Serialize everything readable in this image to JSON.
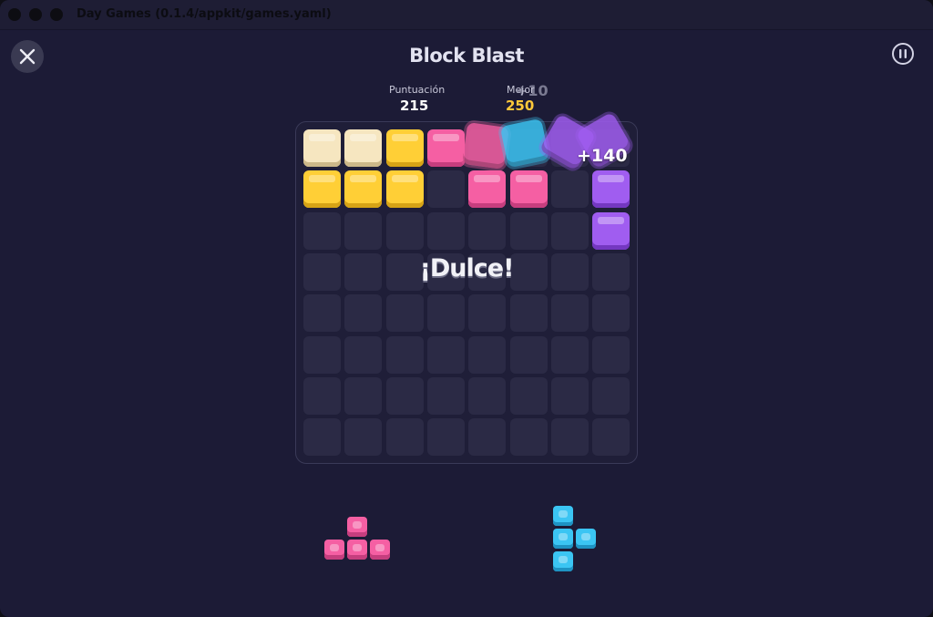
{
  "window": {
    "title": "Day Games (0.1.4/appkit/games.yaml)"
  },
  "header": {
    "title": "Block Blast"
  },
  "scores": {
    "score_label": "Puntuación",
    "score_value": "215",
    "best_label": "Mejor",
    "best_value": "250",
    "ghost_points": "+10"
  },
  "combo": {
    "text": "¡Dulce!",
    "points": "+140"
  },
  "board": {
    "rows": 8,
    "cols": 8,
    "filled": [
      {
        "row": 0,
        "col": 0,
        "color": "cream"
      },
      {
        "row": 0,
        "col": 1,
        "color": "cream"
      },
      {
        "row": 0,
        "col": 2,
        "color": "yellow"
      },
      {
        "row": 0,
        "col": 3,
        "color": "pink"
      },
      {
        "row": 1,
        "col": 0,
        "color": "yellow"
      },
      {
        "row": 1,
        "col": 1,
        "color": "yellow"
      },
      {
        "row": 1,
        "col": 2,
        "color": "yellow"
      },
      {
        "row": 1,
        "col": 4,
        "color": "pink"
      },
      {
        "row": 1,
        "col": 5,
        "color": "pink"
      },
      {
        "row": 1,
        "col": 7,
        "color": "purple"
      },
      {
        "row": 2,
        "col": 7,
        "color": "purple"
      }
    ]
  },
  "clearing_blocks": [
    "pink",
    "cyan",
    "purple",
    "purple"
  ],
  "tray": {
    "pieces": [
      {
        "name": "pink-t-piece",
        "color": "pink",
        "cells": [
          [
            0,
            1
          ],
          [
            1,
            0
          ],
          [
            1,
            1
          ],
          [
            1,
            2
          ]
        ]
      },
      {
        "name": "cyan-t-piece",
        "color": "cyan",
        "cells": [
          [
            0,
            0
          ],
          [
            1,
            0
          ],
          [
            1,
            1
          ],
          [
            2,
            0
          ]
        ]
      }
    ]
  },
  "colors": {
    "cream": "#f6e6c0",
    "yellow": "#ffcf36",
    "pink": "#f55fa3",
    "purple": "#a05df0",
    "cyan": "#3bc5f3",
    "best_score": "#ffc93a",
    "background": "#1c1b36"
  }
}
